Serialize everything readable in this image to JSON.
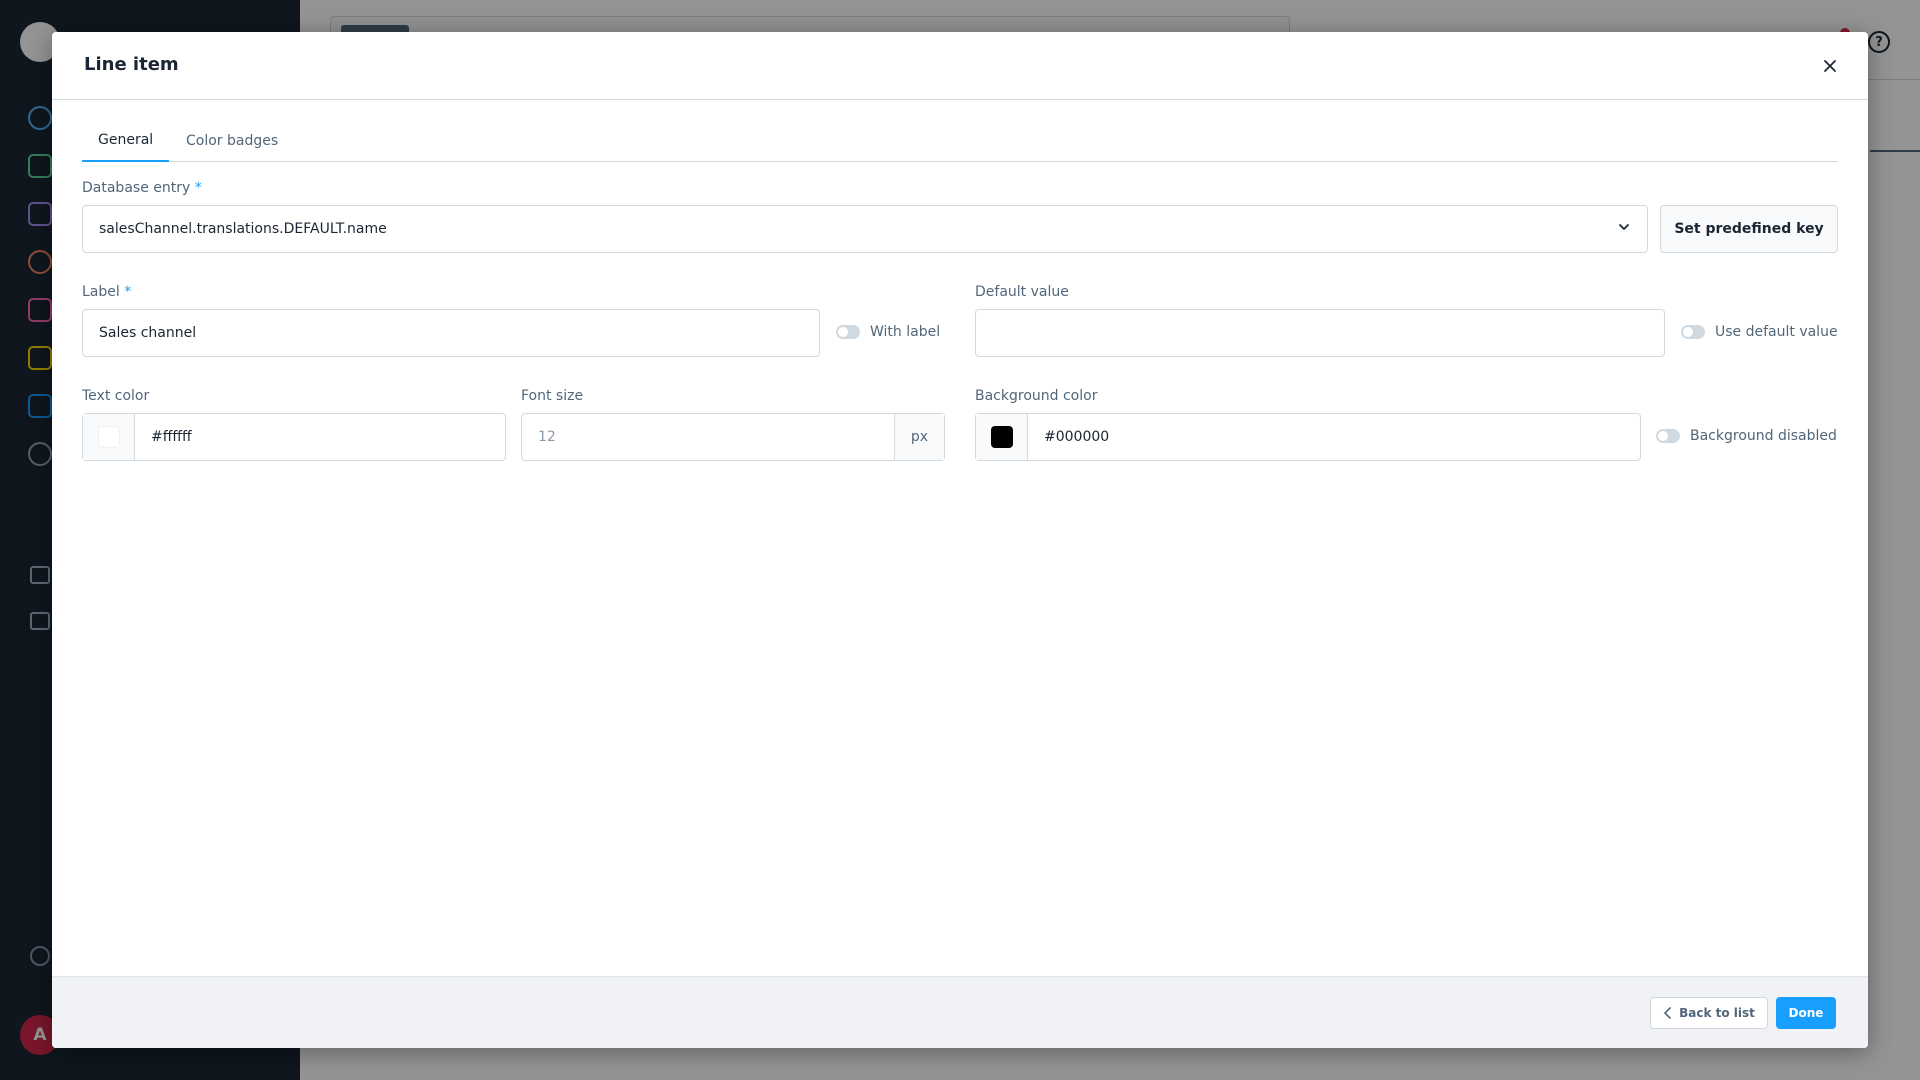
{
  "modal": {
    "title": "Line item",
    "close_icon": "close-icon"
  },
  "tabs": [
    {
      "label": "General",
      "active": true
    },
    {
      "label": "Color badges",
      "active": false
    }
  ],
  "database_entry": {
    "label": "Database entry",
    "required_mark": "*",
    "value": "salesChannel.translations.DEFAULT.name",
    "set_key_button": "Set predefined key"
  },
  "label_field": {
    "label": "Label",
    "required_mark": "*",
    "value": "Sales channel",
    "switch_label": "With label",
    "switch_on": false
  },
  "default_value": {
    "label": "Default value",
    "value": "",
    "switch_label": "Use default value",
    "switch_on": false
  },
  "text_color": {
    "label": "Text color",
    "value": "#ffffff",
    "swatch_color": "#ffffff"
  },
  "font_size": {
    "label": "Font size",
    "placeholder": "12",
    "unit": "px"
  },
  "background_color": {
    "label": "Background color",
    "value": "#000000",
    "swatch_color": "#000000",
    "switch_label": "Background disabled",
    "switch_on": false
  },
  "footer": {
    "back_button": "Back to list",
    "done_button": "Done"
  },
  "background_app": {
    "avatar_initial": "A",
    "accent_color": "#189eff"
  }
}
